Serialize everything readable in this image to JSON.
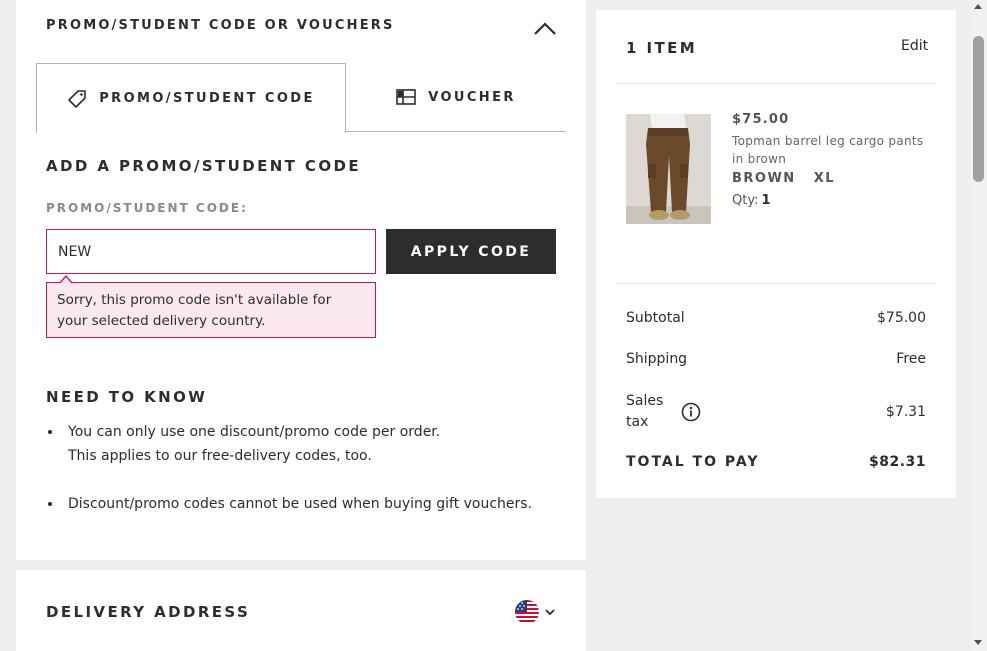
{
  "promo": {
    "header": "PROMO/STUDENT CODE OR VOUCHERS",
    "tabs": [
      {
        "label": "PROMO/STUDENT CODE",
        "icon": "tag-icon",
        "active": true
      },
      {
        "label": "VOUCHER",
        "icon": "voucher-icon",
        "active": false
      }
    ],
    "section_title": "ADD A PROMO/STUDENT CODE",
    "field_label": "PROMO/STUDENT CODE:",
    "input_value": "NEW",
    "apply_label": "APPLY CODE",
    "error_message": "Sorry, this promo code isn't available for your selected delivery country."
  },
  "need_to_know": {
    "title": "NEED TO KNOW",
    "items": [
      {
        "line1": "You can only use one discount/promo code per order.",
        "line2": "This applies to our free-delivery codes, too."
      },
      {
        "line1": "Discount/promo codes cannot be used when buying gift vouchers.",
        "line2": ""
      }
    ]
  },
  "delivery": {
    "title": "DELIVERY ADDRESS",
    "country_icon": "us-flag-icon"
  },
  "summary": {
    "items_count": "1 ITEM",
    "edit_label": "Edit",
    "product": {
      "price": "$75.00",
      "name": "Topman barrel leg cargo pants in brown",
      "color": "BROWN",
      "size": "XL",
      "qty_label": "Qty:",
      "qty_value": "1"
    },
    "subtotal_label": "Subtotal",
    "subtotal_value": "$75.00",
    "shipping_label": "Shipping",
    "shipping_value": "Free",
    "tax_label_1": "Sales",
    "tax_label_2": "tax",
    "tax_value": "$7.31",
    "total_label": "TOTAL TO PAY",
    "total_value": "$82.31"
  },
  "colors": {
    "error": "#c2185b",
    "error_bg": "#fbe9ee",
    "dark": "#2d2d2d",
    "page_bg": "#eeeeee"
  }
}
